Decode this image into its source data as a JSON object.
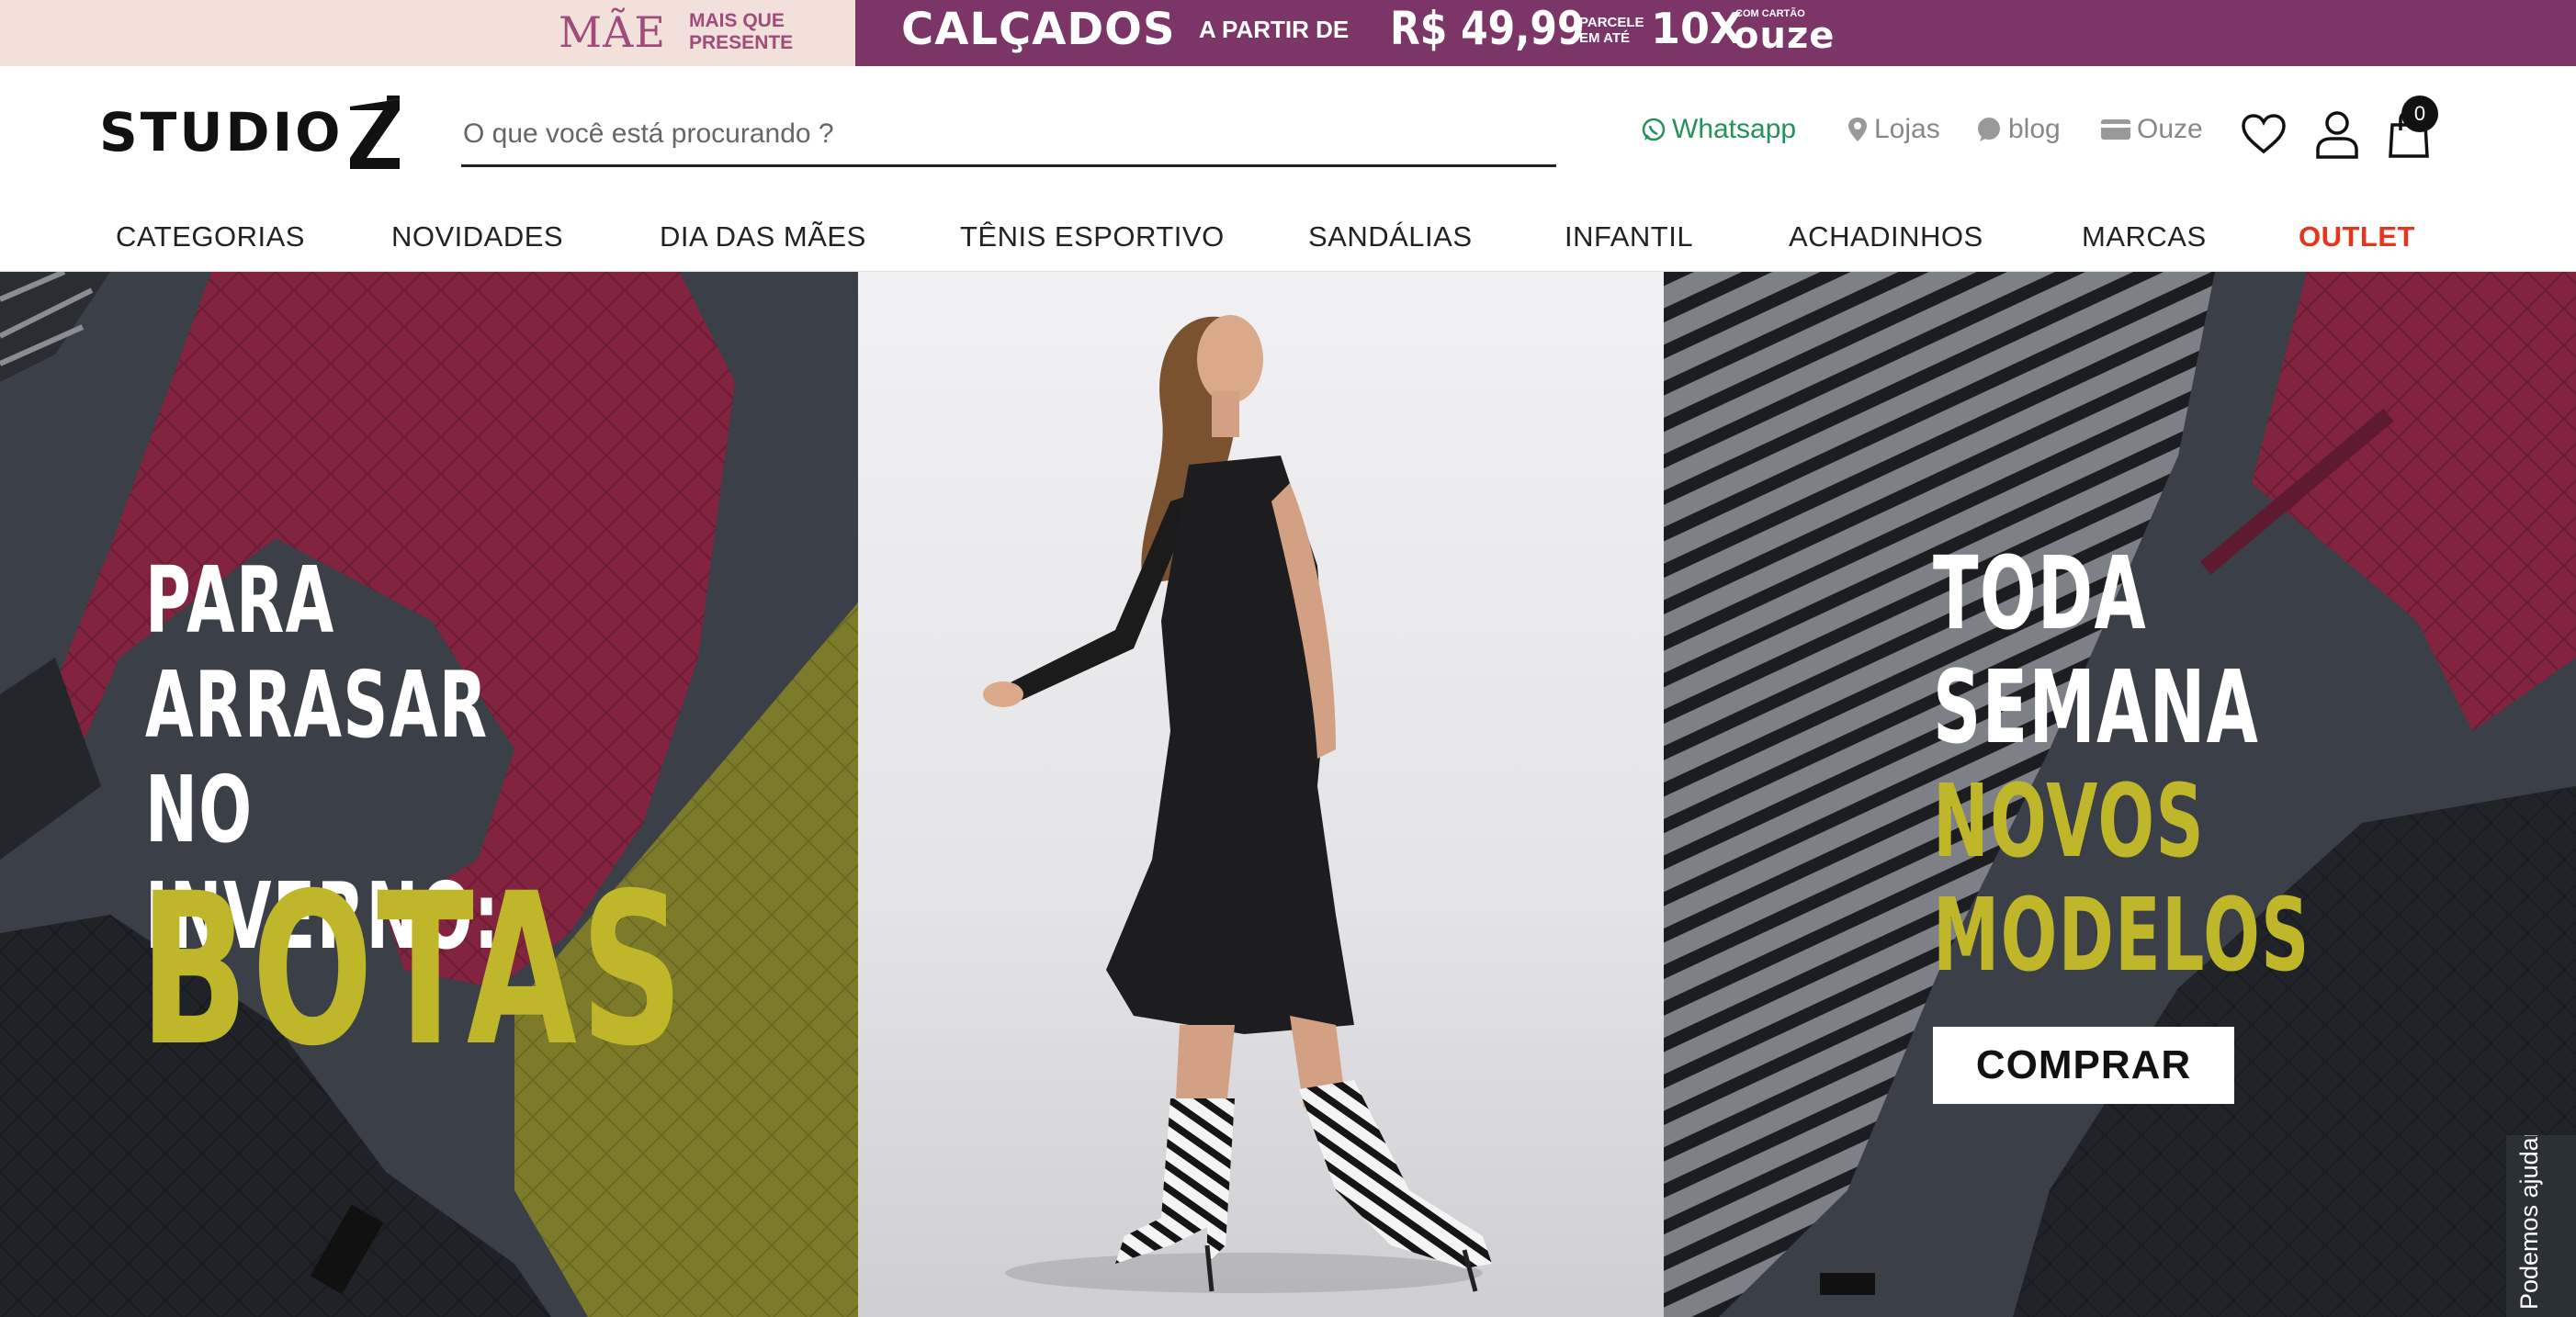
{
  "promo": {
    "mae": "MÃE",
    "mae_sub_1": "MAIS QUE",
    "mae_sub_2": "PRESENTE",
    "calcados": "CALÇADOS",
    "a_partir": "A PARTIR DE",
    "price": "R$ 49,99",
    "parcele_1": "PARCELE",
    "parcele_2": "EM ATÉ",
    "installments": "10X",
    "com_cartao": "COM CARTÃO",
    "card_brand": "OUZE",
    "bg_left": "#f2e1da",
    "bg_right": "#7c3567"
  },
  "header": {
    "logo": "STUDIO",
    "search_placeholder": "O que você está procurando ?",
    "whatsapp": "Whatsapp",
    "lojas": "Lojas",
    "blog": "blog",
    "ouze": "Ouze",
    "cart_count": "0",
    "icons": [
      "whatsapp-icon",
      "map-pin-icon",
      "blog-icon",
      "credit-card-icon",
      "heart-icon",
      "user-icon",
      "shopping-bag-icon"
    ]
  },
  "nav": {
    "items": [
      "CATEGORIAS",
      "NOVIDADES",
      "DIA DAS MÃES",
      "TÊNIS ESPORTIVO",
      "SANDÁLIAS",
      "INFANTIL",
      "ACHADINHOS",
      "MARCAS",
      "OUTLET"
    ],
    "outlet_color": "#e8341d"
  },
  "hero": {
    "left_line_1": "PARA",
    "left_line_2": "ARRASAR",
    "left_line_3": "NO INVERNO:",
    "left_highlight": "BOTAS",
    "right_line_1": "TODA",
    "right_line_2": "SEMANA",
    "right_line_3": "NOVOS",
    "right_line_4": "MODELOS",
    "cta": "COMPRAR",
    "accent": "#c0b62a"
  },
  "help": {
    "label": "Podemos ajudar?"
  }
}
